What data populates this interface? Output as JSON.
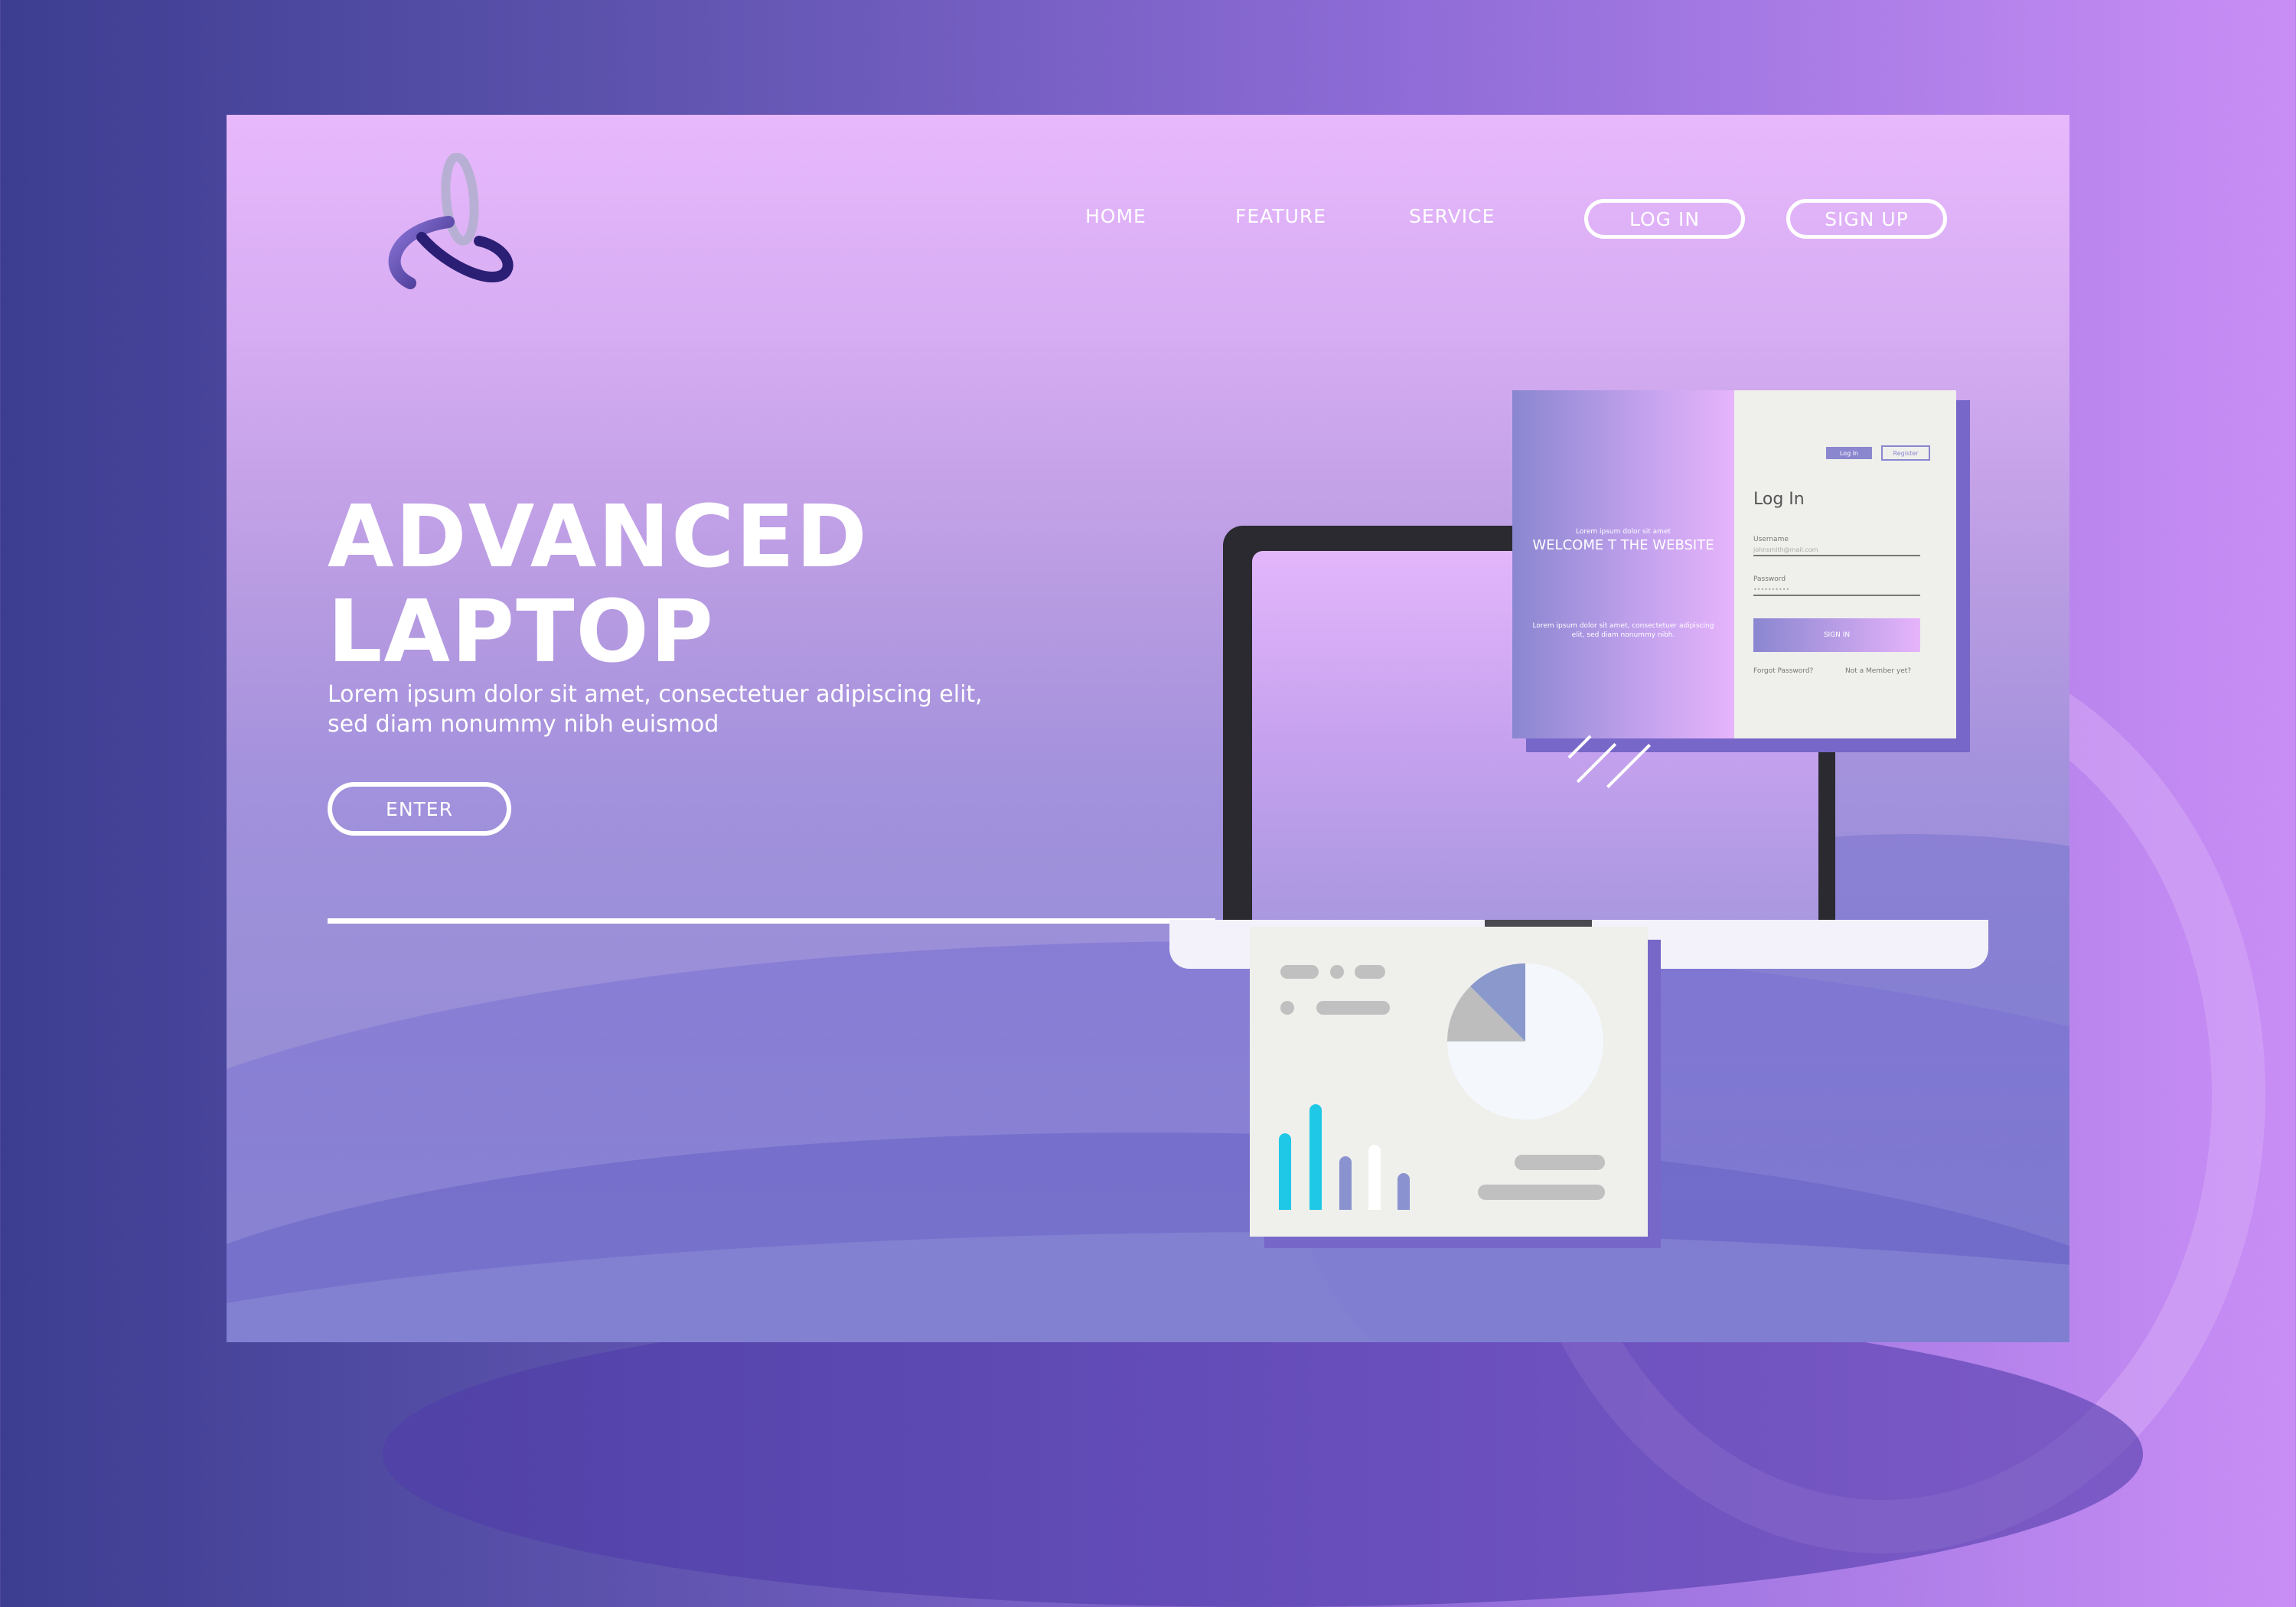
{
  "nav": {
    "home": "HOME",
    "feature": "FEATURE",
    "service": "SERVICE",
    "login": "LOG IN",
    "signup": "SIGN UP"
  },
  "hero": {
    "title_line1": "ADVANCED",
    "title_line2": "LAPTOP",
    "subtitle_line1": "Lorem ipsum dolor sit amet, consectetuer adipiscing elit,",
    "subtitle_line2": "sed diam nonummy nibh euismod",
    "enter": "ENTER"
  },
  "login_card": {
    "small_top": "Lorem ipsum dolor sit amet",
    "welcome": "WELCOME T THE WEBSITE",
    "small_bottom": "Lorem ipsum dolor sit amet, consectetuer adipiscing elit, sed diam nonummy nibh.",
    "tab_login": "Log In",
    "tab_register": "Register",
    "title": "Log In",
    "username_label": "Username",
    "username_value": "johnsmith@mail.com",
    "password_label": "Password",
    "password_value": "••••••••••",
    "signin": "SIGN IN",
    "forgot": "Forgot Password?",
    "not_member": "Not a Member yet?"
  },
  "colors": {
    "accent_purple": "#8b87cf",
    "bar_cyan": "#1ec8e6",
    "bar_periwinkle": "#8a92cf",
    "pie_slice_blue": "#8a98cc",
    "pie_slice_gray": "#bdbdbd"
  },
  "icons": {
    "logo": "triple-orbit-logo",
    "pie": "pie-chart-icon",
    "bars": "bar-chart-icon"
  }
}
